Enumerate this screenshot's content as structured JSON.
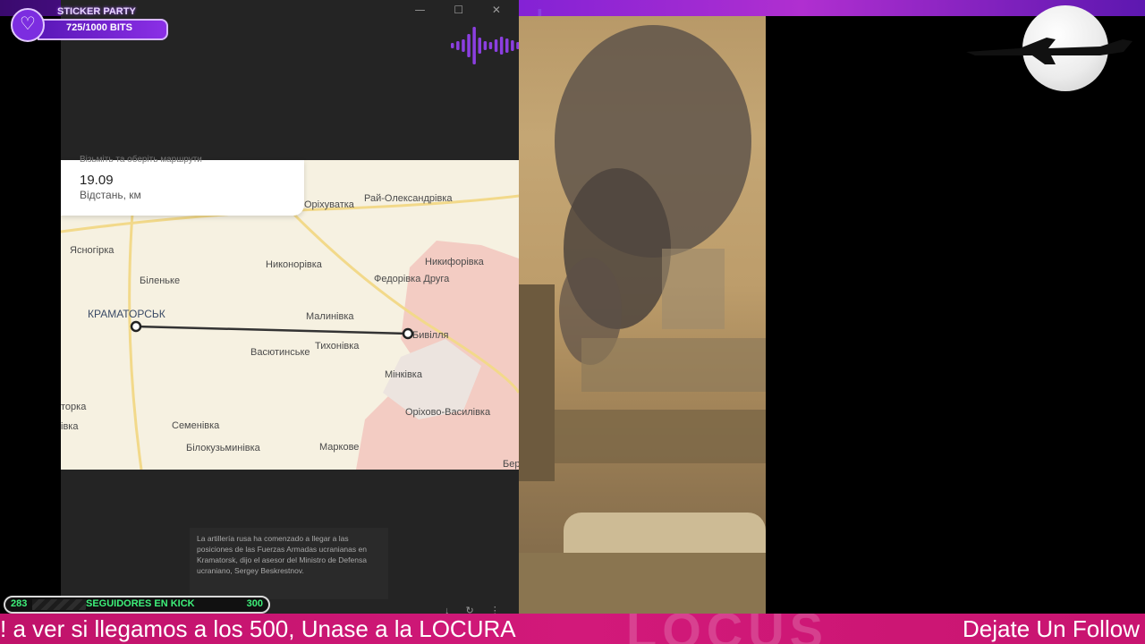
{
  "window": {
    "controls": "—  ☐  ✕"
  },
  "sticker_party": {
    "title": "STICKER PARTY",
    "count": "725/1000 BITS",
    "progress": 0.725,
    "icon": "heart-plus-icon"
  },
  "map": {
    "card": {
      "cut_text": "Візьміть та оберіть маршрути",
      "distance_value": "19.09",
      "distance_label": "Відстань, км"
    },
    "places": {
      "rai": "Рай-Олександрівка",
      "orikhuvatka": "Оріхуватка",
      "yasnohirka": "Ясногірка",
      "nykonorivka": "Никонорівка",
      "nykyforivka": "Никифорівка",
      "bilenke": "Біленьке",
      "fedorivka": "Федорівка Друга",
      "kramatorsk": "КРАМАТОРСЬК",
      "malynivka": "Малинівка",
      "tykhonivka": "Тихонівка",
      "vasiutynske": "Васютинське",
      "bylivlia": "Бивілля",
      "minkivka": "Мінківка",
      "torska": "торка",
      "ivka": "івка",
      "semenivka": "Семенівка",
      "orikhovo": "Оріхово-Василівка",
      "bilokuzmynivka": "Білокузьминівка",
      "markove": "Маркове",
      "ber": "Бер"
    }
  },
  "caption": "La artillería rusa ha comenzado a llegar a las posiciones de las Fuerzas Armadas ucranianas en Kramatorsk, dijo el asesor del Ministro de Defensa ucraniano, Sergey Beskrestnov.",
  "goal": {
    "start": "283",
    "label": "SEGUIDORES EN KICK",
    "end": "300",
    "current": 283
  },
  "ticker": {
    "text": "! a ver si llegamos a los 500, Unase a la LOCURA",
    "text2": "Dejate Un Follow",
    "bg_text": "LOCUS"
  },
  "colors": {
    "accent_purple": "#7c2de0",
    "ticker_pink": "#c0126a",
    "goal_green": "#3ef07a"
  }
}
